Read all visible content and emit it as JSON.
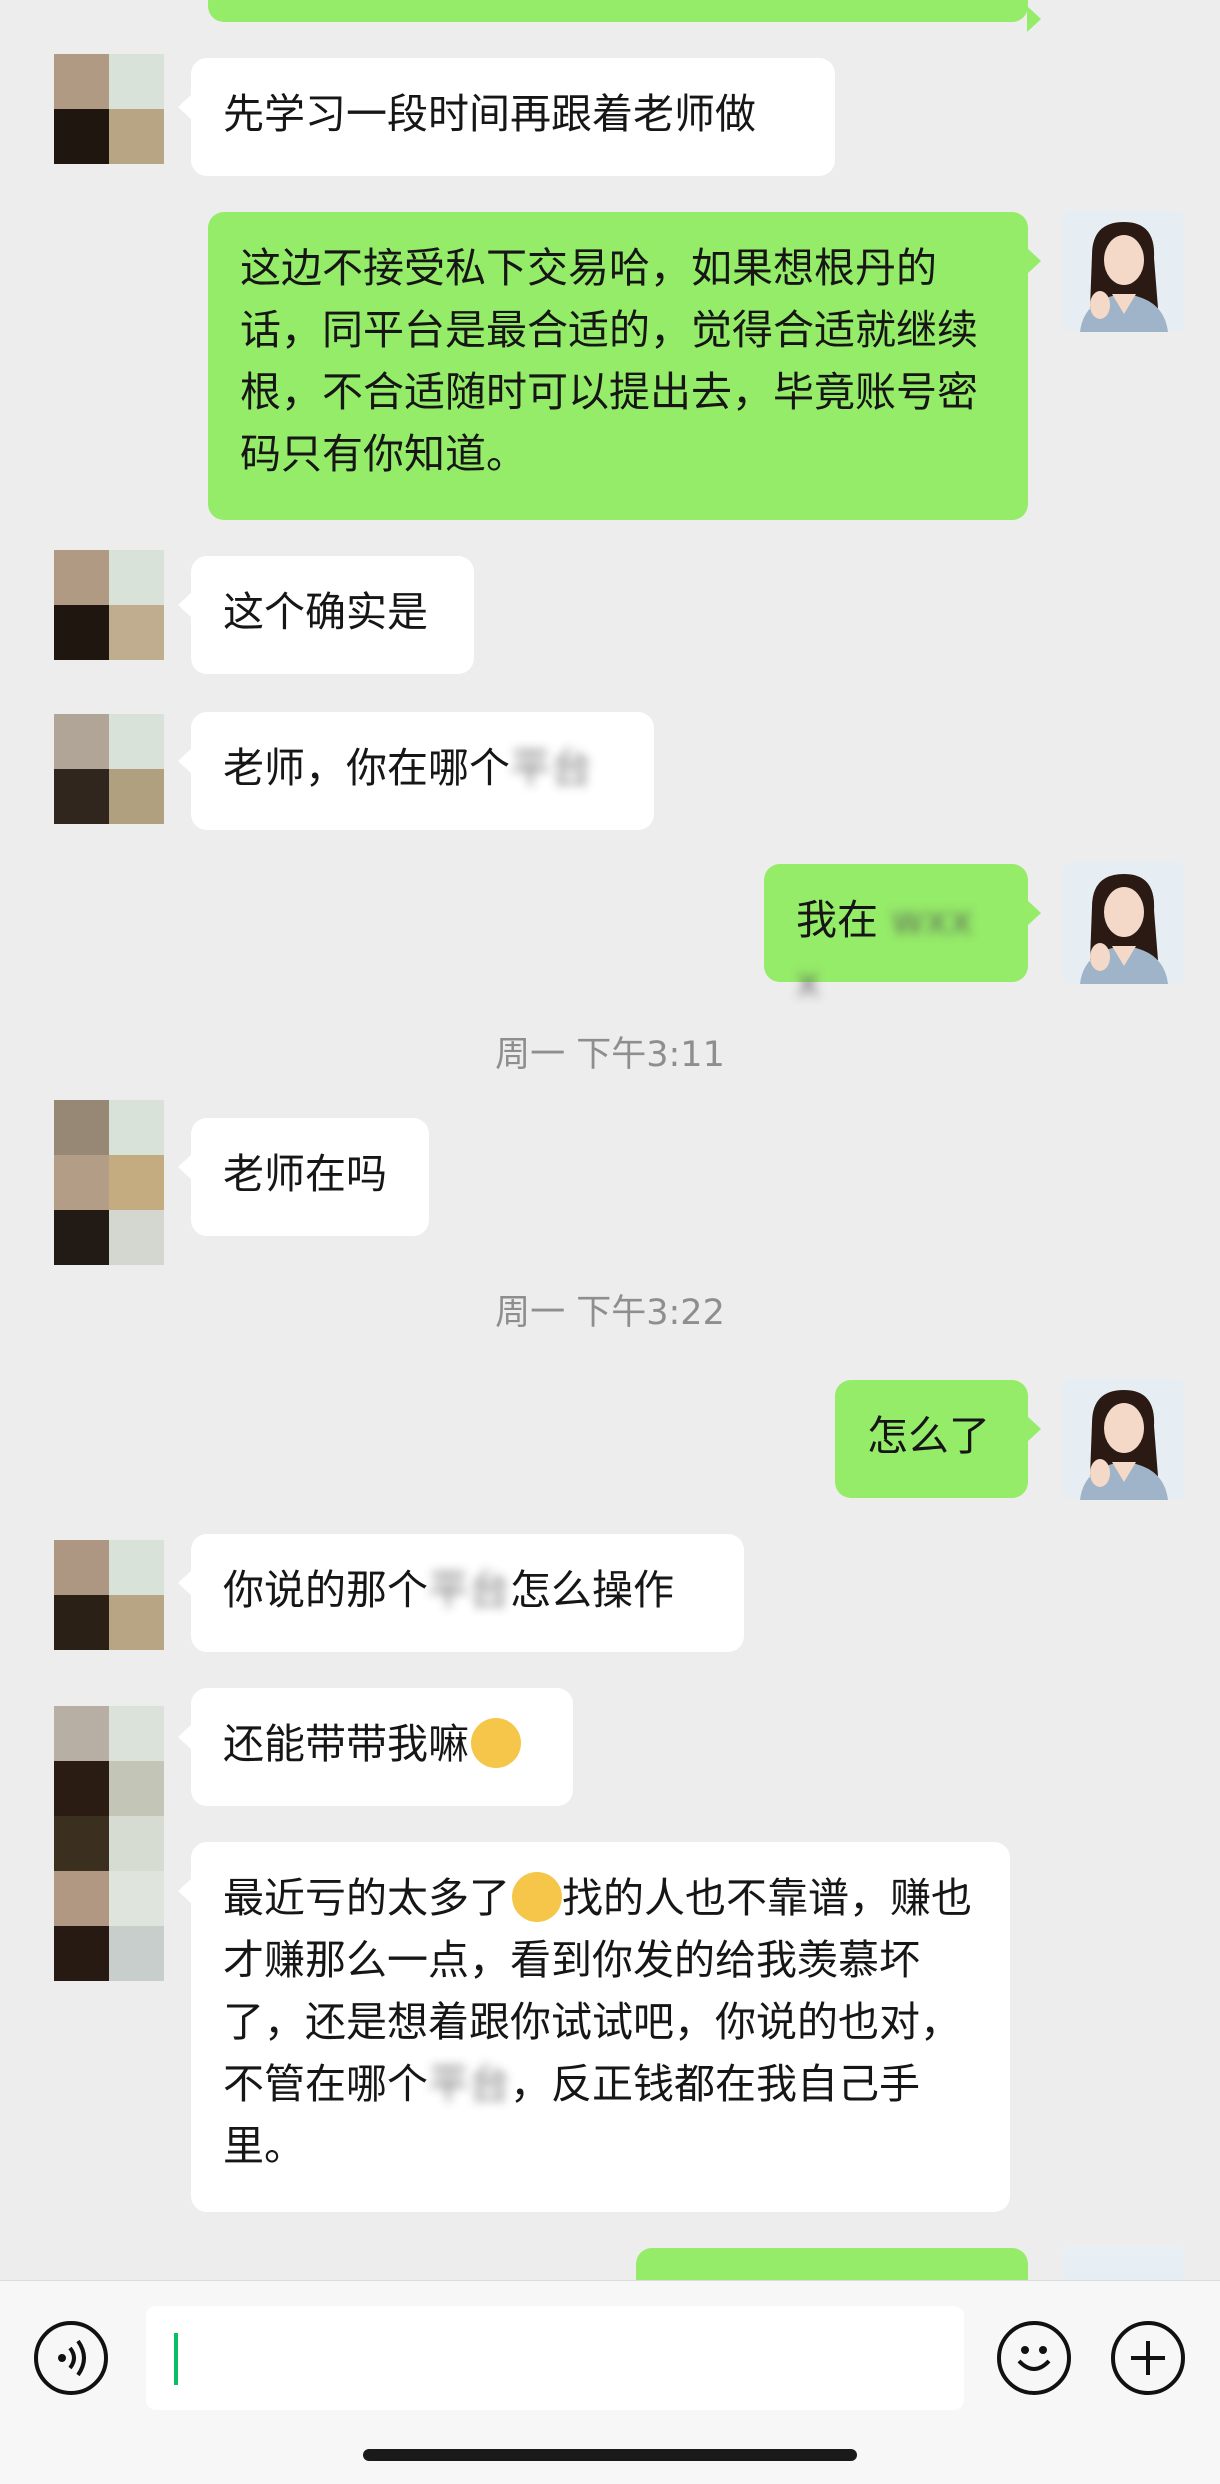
{
  "messages": [
    {
      "side": "in",
      "text": "先学习一段时间再跟着老师做"
    },
    {
      "side": "out",
      "text": "这边不接受私下交易哈，如果想根丹的话，同平台是最合适的，觉得合适就继续根，不合适随时可以提出去，毕竟账号密码只有你知道。"
    },
    {
      "side": "in",
      "text": "这个确实是"
    },
    {
      "side": "in",
      "text": "老师，你在哪个",
      "blurred": "平台"
    },
    {
      "side": "out",
      "text": "我在",
      "blurred": "wxxx"
    },
    {
      "timestamp": "周一 下午3:11"
    },
    {
      "side": "in",
      "text": "老师在吗"
    },
    {
      "timestamp": "周一 下午3:22"
    },
    {
      "side": "out",
      "text": "怎么了"
    },
    {
      "side": "in",
      "text_before": "你说的那个",
      "blurred": "平台",
      "text_after": "怎么操作"
    },
    {
      "side": "in",
      "text": "还能带带我嘛",
      "emoji": "crying-face-icon"
    },
    {
      "side": "in",
      "text_before": "最近亏的太多了",
      "emoji": "persevering-face-icon",
      "text_after": "找的人也不靠谱，赚也才赚那么一点，看到你发的给我羡慕坏了，还是想着跟你试试吧，你说的也对，不管在哪个",
      "blurred": "平台",
      "text_end": "，反正钱都在我自己手里。"
    }
  ],
  "input": {
    "placeholder": "",
    "value": ""
  },
  "icons": {
    "voice": "voice-icon",
    "emoji": "emoji-icon",
    "plus": "plus-icon"
  },
  "colors": {
    "outgoing_bubble": "#95ec69",
    "incoming_bubble": "#ffffff",
    "background": "#ededed",
    "accent": "#07c160"
  }
}
